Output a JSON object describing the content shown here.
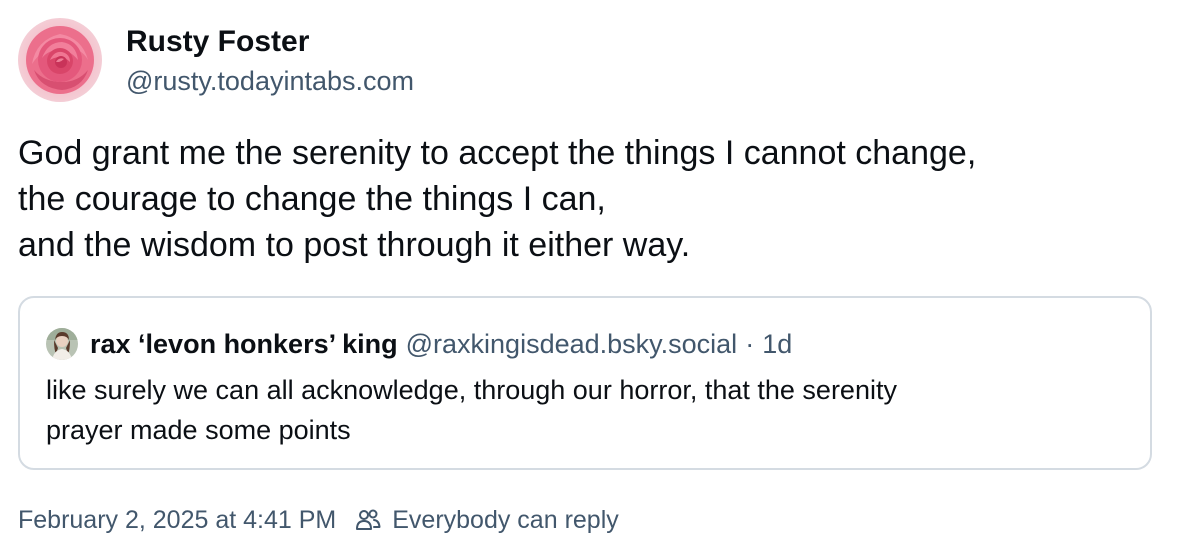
{
  "post": {
    "author": {
      "display_name": "Rusty Foster",
      "handle": "@rusty.todayintabs.com",
      "avatar_icon": "rose-avatar"
    },
    "text_lines": [
      "God grant me the serenity to accept the things I cannot change,",
      "the courage to change the things I can,",
      "and the wisdom to post through it either way."
    ],
    "quote": {
      "author_name": "rax ‘levon honkers’ king",
      "author_handle": "@raxkingisdead.bsky.social",
      "separator": "·",
      "time_ago": "1d",
      "text_lines": [
        "like surely we can all acknowledge, through our horror, that the serenity",
        "prayer made some points"
      ],
      "avatar_icon": "user-photo-avatar"
    },
    "meta": {
      "timestamp": "February 2, 2025 at 4:41 PM",
      "reply_setting_icon": "people-icon",
      "reply_setting_label": "Everybody can reply"
    }
  },
  "colors": {
    "text_primary": "#0b0f14",
    "text_secondary": "#42576c",
    "border": "#d4dbe2",
    "background": "#ffffff",
    "rose": "#e5587a"
  }
}
